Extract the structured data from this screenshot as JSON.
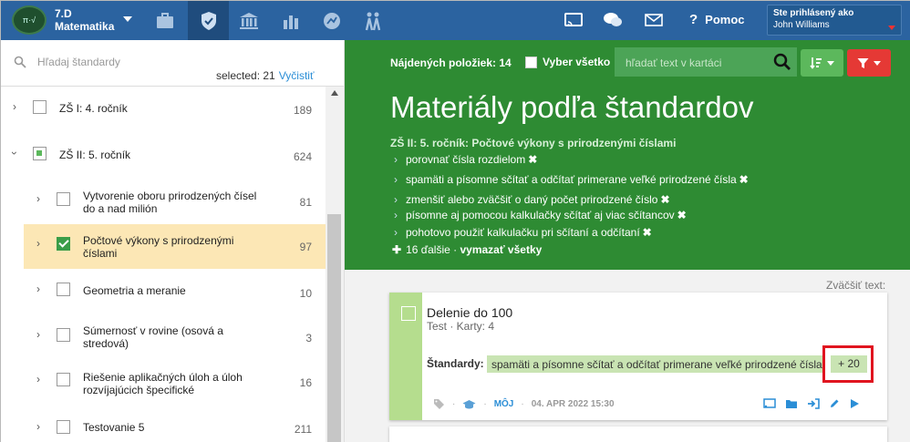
{
  "topbar": {
    "class_name": "7.D",
    "subject": "Matematika",
    "help_label": "Pomoc",
    "user_label": "Ste prihlásený ako",
    "user_name": "John Williams"
  },
  "sidebar": {
    "search_placeholder": "Hľadaj štandardy",
    "selected_text": "selected: 21",
    "clear_label": "Vyčistiť",
    "items": [
      {
        "label": "ZŠ I: 4. ročník",
        "count": "189",
        "state": "unchecked"
      },
      {
        "label": "ZŠ II: 5. ročník",
        "count": "624",
        "state": "partial"
      },
      {
        "label": "Vytvorenie oboru prirodzených čísel do a nad milión",
        "count": "81",
        "state": "unchecked"
      },
      {
        "label": "Počtové výkony s prirodzenými číslami",
        "count": "97",
        "state": "checked"
      },
      {
        "label": "Geometria a meranie",
        "count": "10",
        "state": "unchecked"
      },
      {
        "label": "Súmernosť v rovine (osová a stredová)",
        "count": "3",
        "state": "unchecked"
      },
      {
        "label": "Riešenie aplikačných úloh a úloh rozvíjajúcich špecifické",
        "count": "16",
        "state": "unchecked"
      },
      {
        "label": "Testovanie 5",
        "count": "211",
        "state": "unchecked"
      }
    ]
  },
  "main": {
    "found_label": "Nájdených položiek: 14",
    "select_all_label": "Vyber všetko",
    "card_search_placeholder": "hľadať text v kartáci",
    "title": "Materiály podľa štandardov",
    "breadcrumb": "ZŠ II: 5. ročník: Počtové výkony s prirodzenými číslami",
    "standards": [
      "porovnať čísla rozdielom",
      "spamäti a písomne sčítať a odčítať primerane veľké prirodzené čísla",
      "zmenšiť alebo zväčšiť o daný počet prirodzené číslo",
      "písomne aj pomocou kalkulačky sčítať aj viac sčítancov",
      "pohotovo použiť kalkulačku pri sčítaní a odčítaní"
    ],
    "more_text": "16 ďalšie ·",
    "clear_all_label": "vymazať všetky",
    "zoom_label": "Zväčšiť text:"
  },
  "card": {
    "title": "Delenie do 100",
    "subtitle": "Test · Karty: 4",
    "standards_label": "Štandardy:",
    "standard_tag": "spamäti a písomne sčítať a odčítať primerane veľké prirodzené čísla",
    "plus_label": "+ 20",
    "owner_label": "MÔJ",
    "date": "04. APR 2022 15:30"
  },
  "colors": {
    "topbar": "#2b63a0",
    "green": "#2e8b33",
    "highlight": "#fce7b5",
    "filter_button": "#e53935",
    "red_outline": "#e0141f"
  }
}
